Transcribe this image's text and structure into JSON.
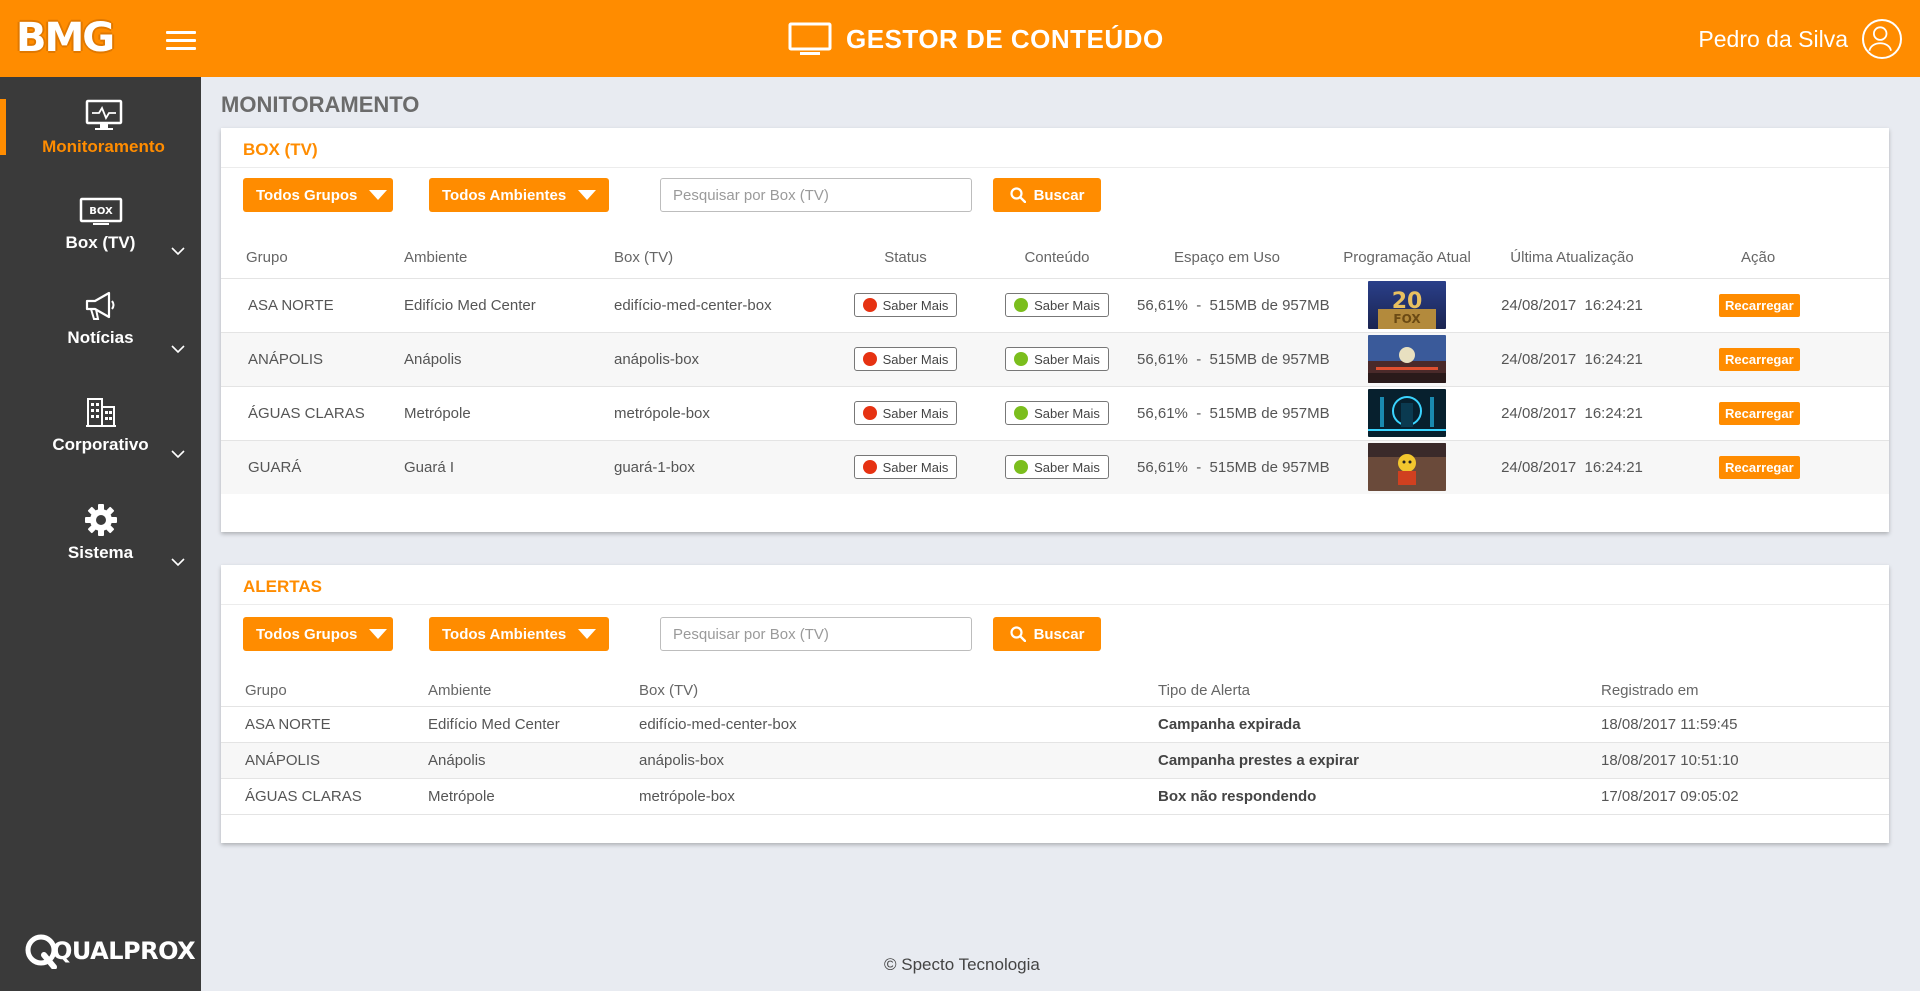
{
  "header": {
    "logo": "BMG",
    "title": "GESTOR DE CONTEÚDO",
    "user_name": "Pedro da Silva"
  },
  "sidebar": {
    "items": [
      {
        "label": "Monitoramento",
        "icon": "monitor-pulse-icon",
        "active": true
      },
      {
        "label": "Box (TV)",
        "icon": "box-tv-icon",
        "badge": "BOX"
      },
      {
        "label": "Notícias",
        "icon": "megaphone-icon"
      },
      {
        "label": "Corporativo",
        "icon": "building-icon"
      },
      {
        "label": "Sistema",
        "icon": "gear-icon"
      }
    ],
    "brand": "QUALPROX"
  },
  "page_title": "MONITORAMENTO",
  "box_section": {
    "title": "BOX (TV)",
    "filter_groups": "Todos Grupos",
    "filter_env": "Todos Ambientes",
    "search_placeholder": "Pesquisar por Box (TV)",
    "search_button": "Buscar",
    "columns": [
      "Grupo",
      "Ambiente",
      "Box (TV)",
      "Status",
      "Conteúdo",
      "Espaço em Uso",
      "Programação Atual",
      "Última Atualização",
      "Ação"
    ],
    "rows": [
      {
        "grupo": "ASA NORTE",
        "ambiente": "Edifício Med Center",
        "box": "edifício-med-center-box",
        "status": "Saber Mais",
        "status_color": "#e63212",
        "conteudo": "Saber Mais",
        "conteudo_color": "#7bbe1d",
        "espaco": "56,61%  -  515MB de 957MB",
        "programacao": "20th Century Fox",
        "atualizacao": "24/08/2017  16:24:21",
        "acao": "Recarregar"
      },
      {
        "grupo": "ANÁPOLIS",
        "ambiente": "Anápolis",
        "box": "anápolis-box",
        "status": "Saber Mais",
        "status_color": "#e63212",
        "conteudo": "Saber Mais",
        "conteudo_color": "#7bbe1d",
        "espaco": "56,61%  -  515MB de 957MB",
        "programacao": "concert",
        "atualizacao": "24/08/2017  16:24:21",
        "acao": "Recarregar"
      },
      {
        "grupo": "ÁGUAS CLARAS",
        "ambiente": "Metrópole",
        "box": "metrópole-box",
        "status": "Saber Mais",
        "status_color": "#e63212",
        "conteudo": "Saber Mais",
        "conteudo_color": "#7bbe1d",
        "espaco": "56,61%  -  515MB de 957MB",
        "programacao": "tron",
        "atualizacao": "24/08/2017  16:24:21",
        "acao": "Recarregar"
      },
      {
        "grupo": "GUARÁ",
        "ambiente": "Guará I",
        "box": "guará-1-box",
        "status": "Saber Mais",
        "status_color": "#e63212",
        "conteudo": "Saber Mais",
        "conteudo_color": "#7bbe1d",
        "espaco": "56,61%  -  515MB de 957MB",
        "programacao": "lego",
        "atualizacao": "24/08/2017  16:24:21",
        "acao": "Recarregar"
      }
    ]
  },
  "alerts_section": {
    "title": "ALERTAS",
    "filter_groups": "Todos Grupos",
    "filter_env": "Todos Ambientes",
    "search_placeholder": "Pesquisar por Box (TV)",
    "search_button": "Buscar",
    "columns": [
      "Grupo",
      "Ambiente",
      "Box (TV)",
      "Tipo de Alerta",
      "Registrado em"
    ],
    "rows": [
      {
        "grupo": "ASA NORTE",
        "ambiente": "Edifício Med Center",
        "box": "edifício-med-center-box",
        "tipo": "Campanha expirada",
        "registrado": "18/08/2017 11:59:45"
      },
      {
        "grupo": "ANÁPOLIS",
        "ambiente": "Anápolis",
        "box": "anápolis-box",
        "tipo": "Campanha prestes a expirar",
        "registrado": "18/08/2017 10:51:10"
      },
      {
        "grupo": "ÁGUAS CLARAS",
        "ambiente": "Metrópole",
        "box": "metrópole-box",
        "tipo": "Box não respondendo",
        "registrado": "17/08/2017 09:05:02"
      }
    ]
  },
  "footer": "© Specto Tecnologia",
  "colors": {
    "accent": "#ff8c00",
    "sidebar": "#3a3a3a",
    "background": "#e8ebf1"
  }
}
